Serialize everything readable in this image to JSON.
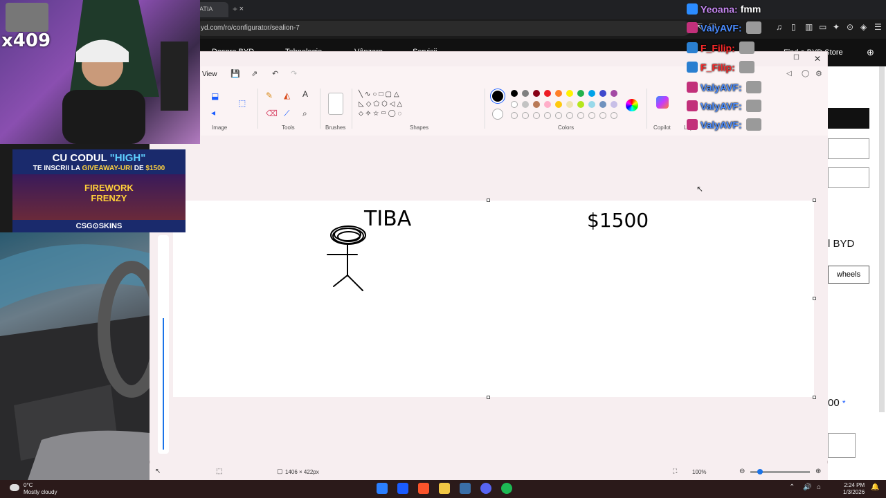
{
  "browser": {
    "tab_title": "ATIA",
    "tab_close": "×",
    "new_tab": "+",
    "url": "yd.com/ro/configurator/sealion-7"
  },
  "website": {
    "nav": [
      "Despre BYD",
      "Tehnologie",
      "Vânzare",
      "Servicii"
    ],
    "find_store": "Find a BYD Store",
    "brand_fragment": "l BYD",
    "wheels_button": "wheels",
    "price_fragment": "00",
    "price_star": "*"
  },
  "paint": {
    "menu_view": "View",
    "groups": {
      "image": "Image",
      "tools": "Tools",
      "brushes": "Brushes",
      "shapes": "Shapes",
      "colors": "Colors",
      "copilot": "Copilot",
      "layers": "Lay"
    },
    "canvas_size": "1406 × 422px",
    "zoom": "100%",
    "drawing_text_left": "TIBA",
    "drawing_text_right": "$1500"
  },
  "chat": [
    {
      "name": "Yeoana:",
      "message": "fmm",
      "name_color": "#c98af5",
      "badge": "hammer-crown"
    },
    {
      "name": "ValyAVF:",
      "message": "",
      "name_color": "#4a8cff",
      "badge": "pink-monster"
    },
    {
      "name": "F_Filip:",
      "message": "",
      "name_color": "#ff2a2a",
      "badge": "blue-monster"
    },
    {
      "name": "F_Filip:",
      "message": "",
      "name_color": "#ff2a2a",
      "badge": "blue-monster"
    },
    {
      "name": "ValyAVF:",
      "message": "",
      "name_color": "#4a8cff",
      "badge": "pink-monster"
    },
    {
      "name": "ValyAVF:",
      "message": "",
      "name_color": "#4a8cff",
      "badge": "pink-monster"
    },
    {
      "name": "ValyAVF:",
      "message": "",
      "name_color": "#4a8cff",
      "badge": "pink-monster"
    }
  ],
  "stream": {
    "counter": "x409",
    "promo_line1_pre": "CU CODUL ",
    "promo_line1_code": "\"HIGH\"",
    "promo_line2_pre": "TE INSCRII LA ",
    "promo_line2_hl": "GIVEAWAY-URI",
    "promo_line2_mid": " DE ",
    "promo_line2_amount": "$1500",
    "game_title_1": "FIREWORK",
    "game_title_2": "FRENZY",
    "brand": "CSG⊙SKINS"
  },
  "taskbar": {
    "temperature": "0°C",
    "weather": "Mostly cloudy",
    "time": "2:24 PM",
    "date": "1/3/2026"
  },
  "colors": {
    "palette_row1": [
      "#000000",
      "#7f7f7f",
      "#880015",
      "#ed1c24",
      "#ff7f27",
      "#fff200",
      "#22b14c",
      "#00a2e8",
      "#3f48cc",
      "#a349a4"
    ],
    "palette_row2": [
      "#ffffff",
      "#c3c3c3",
      "#b97a57",
      "#ffaec9",
      "#ffc90e",
      "#efe4b0",
      "#b5e61d",
      "#99d9ea",
      "#7092be",
      "#c8bfe7"
    ]
  }
}
